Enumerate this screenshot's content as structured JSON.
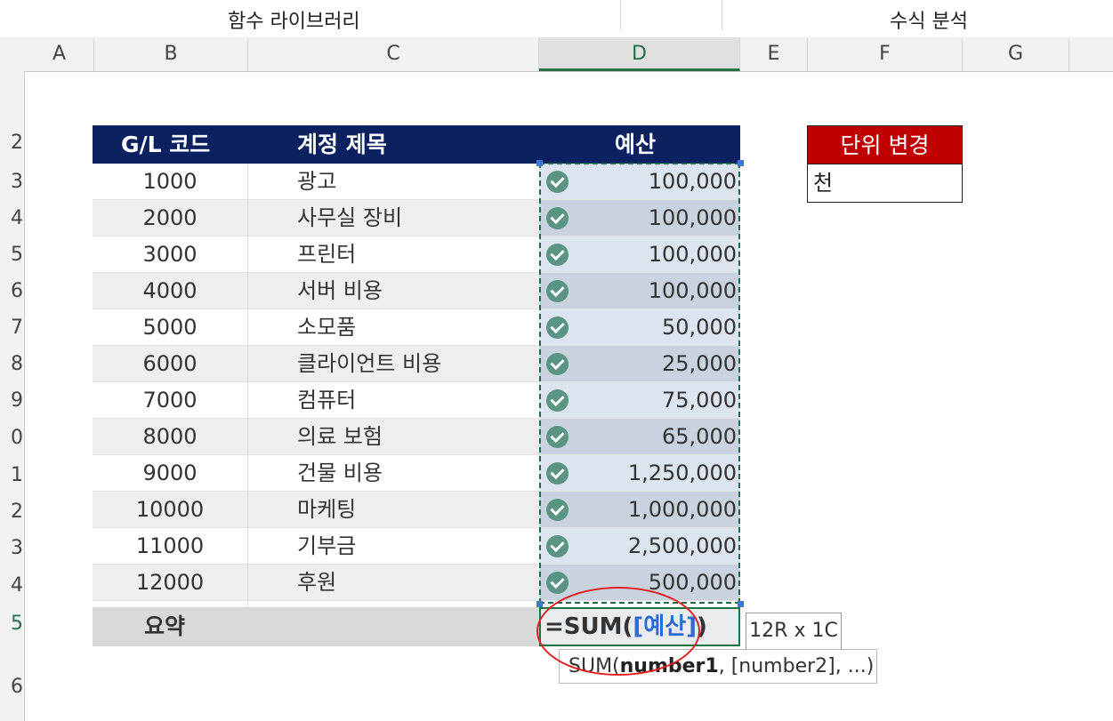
{
  "ribbon": {
    "group_left": "함수 라이브러리",
    "group_right": "수식 분석"
  },
  "columns": [
    "A",
    "B",
    "C",
    "D",
    "E",
    "F",
    "G"
  ],
  "active_column": "D",
  "row_headers": [
    "2",
    "3",
    "4",
    "5",
    "6",
    "7",
    "8",
    "9",
    "0",
    "1",
    "2",
    "3",
    "4",
    "5",
    "6"
  ],
  "table": {
    "headers": {
      "code": "G/L 코드",
      "account": "계정 제목",
      "budget": "예산"
    },
    "rows": [
      {
        "code": "1000",
        "account": "광고",
        "budget": "100,000"
      },
      {
        "code": "2000",
        "account": "사무실 장비",
        "budget": "100,000"
      },
      {
        "code": "3000",
        "account": "프린터",
        "budget": "100,000"
      },
      {
        "code": "4000",
        "account": "서버 비용",
        "budget": "100,000"
      },
      {
        "code": "5000",
        "account": "소모품",
        "budget": "50,000"
      },
      {
        "code": "6000",
        "account": "클라이언트 비용",
        "budget": "25,000"
      },
      {
        "code": "7000",
        "account": "컴퓨터",
        "budget": "75,000"
      },
      {
        "code": "8000",
        "account": "의료 보험",
        "budget": "65,000"
      },
      {
        "code": "9000",
        "account": "건물 비용",
        "budget": "1,250,000"
      },
      {
        "code": "10000",
        "account": "마케팅",
        "budget": "1,000,000"
      },
      {
        "code": "11000",
        "account": "기부금",
        "budget": "2,500,000"
      },
      {
        "code": "12000",
        "account": "후원",
        "budget": "500,000"
      }
    ],
    "summary_label": "요약",
    "formula_prefix": "=SUM(",
    "formula_ref": "[예산]",
    "formula_suffix": ")"
  },
  "tooltips": {
    "dimension": "12R x 1C",
    "fn_name": "SUM(",
    "fn_arg1": "number1",
    "fn_rest": ", [number2], ...)"
  },
  "unit_box": {
    "header": "단위 변경",
    "value": "천"
  },
  "colors": {
    "header_navy": "#0b2160",
    "unit_red": "#c00000",
    "excel_green": "#217346",
    "check_teal": "#5a9482"
  },
  "icons": [
    "check-circle-icon",
    "select-all-icon"
  ]
}
